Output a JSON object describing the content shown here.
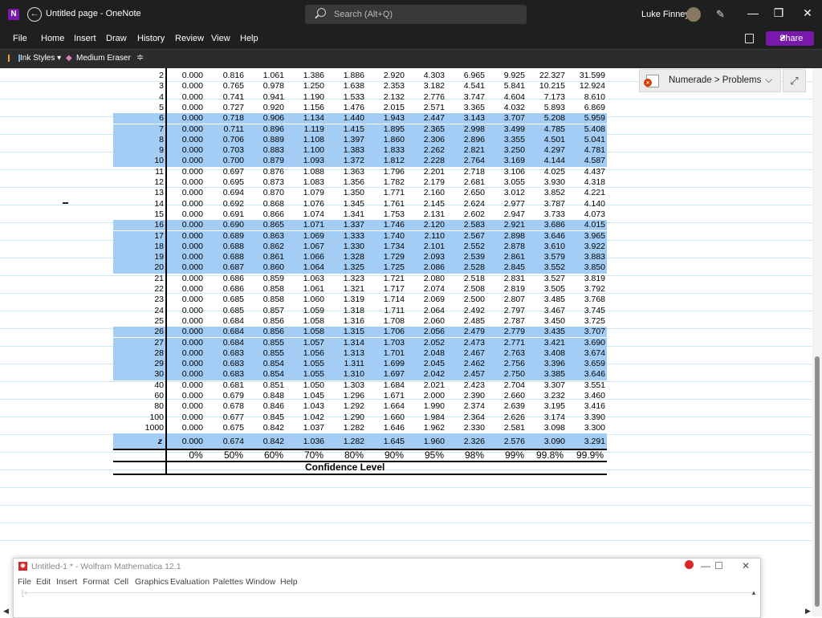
{
  "titlebar": {
    "logo": "N",
    "title": "Untitled page  -  OneNote",
    "search_placeholder": "Search (Alt+Q)",
    "user_name": "Luke Finney",
    "minimize": "—",
    "restore": "❐",
    "close": "✕"
  },
  "menu": {
    "items": [
      "File",
      "Home",
      "Insert",
      "Draw",
      "History",
      "Review",
      "View",
      "Help"
    ],
    "share": "Share"
  },
  "ribbon": {
    "ink_styles": "Ink Styles ▾",
    "eraser": "Medium Eraser",
    "more": "≑"
  },
  "numerade": {
    "label": "Numerade > Problems",
    "chevron": "⌵",
    "expand": "⤢"
  },
  "table": {
    "columns_pct": [
      "0%",
      "50%",
      "60%",
      "70%",
      "80%",
      "90%",
      "95%",
      "98%",
      "99%",
      "99.8%",
      "99.9%"
    ],
    "footer_label": "Confidence Level",
    "z_label": "z",
    "z_values": [
      "0.000",
      "0.674",
      "0.842",
      "1.036",
      "1.282",
      "1.645",
      "1.960",
      "2.326",
      "2.576",
      "3.090",
      "3.291"
    ],
    "rows": [
      {
        "df": "2",
        "hl": false,
        "v": [
          "0.000",
          "0.816",
          "1.061",
          "1.386",
          "1.886",
          "2.920",
          "4.303",
          "6.965",
          "9.925",
          "22.327",
          "31.599"
        ]
      },
      {
        "df": "3",
        "hl": false,
        "v": [
          "0.000",
          "0.765",
          "0.978",
          "1.250",
          "1.638",
          "2.353",
          "3.182",
          "4.541",
          "5.841",
          "10.215",
          "12.924"
        ]
      },
      {
        "df": "4",
        "hl": false,
        "v": [
          "0.000",
          "0.741",
          "0.941",
          "1.190",
          "1.533",
          "2.132",
          "2.776",
          "3.747",
          "4.604",
          "7.173",
          "8.610"
        ]
      },
      {
        "df": "5",
        "hl": false,
        "v": [
          "0.000",
          "0.727",
          "0.920",
          "1.156",
          "1.476",
          "2.015",
          "2.571",
          "3.365",
          "4.032",
          "5.893",
          "6.869"
        ]
      },
      {
        "df": "6",
        "hl": true,
        "v": [
          "0.000",
          "0.718",
          "0.906",
          "1.134",
          "1.440",
          "1.943",
          "2.447",
          "3.143",
          "3.707",
          "5.208",
          "5.959"
        ]
      },
      {
        "df": "7",
        "hl": true,
        "v": [
          "0.000",
          "0.711",
          "0.896",
          "1.119",
          "1.415",
          "1.895",
          "2.365",
          "2.998",
          "3.499",
          "4.785",
          "5.408"
        ]
      },
      {
        "df": "8",
        "hl": true,
        "v": [
          "0.000",
          "0.706",
          "0.889",
          "1.108",
          "1.397",
          "1.860",
          "2.306",
          "2.896",
          "3.355",
          "4.501",
          "5.041"
        ]
      },
      {
        "df": "9",
        "hl": true,
        "v": [
          "0.000",
          "0.703",
          "0.883",
          "1.100",
          "1.383",
          "1.833",
          "2.262",
          "2.821",
          "3.250",
          "4.297",
          "4.781"
        ]
      },
      {
        "df": "10",
        "hl": true,
        "v": [
          "0.000",
          "0.700",
          "0.879",
          "1.093",
          "1.372",
          "1.812",
          "2.228",
          "2.764",
          "3.169",
          "4.144",
          "4.587"
        ]
      },
      {
        "df": "11",
        "hl": false,
        "v": [
          "0.000",
          "0.697",
          "0.876",
          "1.088",
          "1.363",
          "1.796",
          "2.201",
          "2.718",
          "3.106",
          "4.025",
          "4.437"
        ]
      },
      {
        "df": "12",
        "hl": false,
        "v": [
          "0.000",
          "0.695",
          "0.873",
          "1.083",
          "1.356",
          "1.782",
          "2.179",
          "2.681",
          "3.055",
          "3.930",
          "4.318"
        ]
      },
      {
        "df": "13",
        "hl": false,
        "v": [
          "0.000",
          "0.694",
          "0.870",
          "1.079",
          "1.350",
          "1.771",
          "2.160",
          "2.650",
          "3.012",
          "3.852",
          "4.221"
        ]
      },
      {
        "df": "14",
        "hl": false,
        "v": [
          "0.000",
          "0.692",
          "0.868",
          "1.076",
          "1.345",
          "1.761",
          "2.145",
          "2.624",
          "2.977",
          "3.787",
          "4.140"
        ]
      },
      {
        "df": "15",
        "hl": false,
        "v": [
          "0.000",
          "0.691",
          "0.866",
          "1.074",
          "1.341",
          "1.753",
          "2.131",
          "2.602",
          "2.947",
          "3.733",
          "4.073"
        ]
      },
      {
        "df": "16",
        "hl": true,
        "v": [
          "0.000",
          "0.690",
          "0.865",
          "1.071",
          "1.337",
          "1.746",
          "2.120",
          "2.583",
          "2.921",
          "3.686",
          "4.015"
        ]
      },
      {
        "df": "17",
        "hl": true,
        "v": [
          "0.000",
          "0.689",
          "0.863",
          "1.069",
          "1.333",
          "1.740",
          "2.110",
          "2.567",
          "2.898",
          "3.646",
          "3.965"
        ]
      },
      {
        "df": "18",
        "hl": true,
        "v": [
          "0.000",
          "0.688",
          "0.862",
          "1.067",
          "1.330",
          "1.734",
          "2.101",
          "2.552",
          "2.878",
          "3.610",
          "3.922"
        ]
      },
      {
        "df": "19",
        "hl": true,
        "v": [
          "0.000",
          "0.688",
          "0.861",
          "1.066",
          "1.328",
          "1.729",
          "2.093",
          "2.539",
          "2.861",
          "3.579",
          "3.883"
        ]
      },
      {
        "df": "20",
        "hl": true,
        "v": [
          "0.000",
          "0.687",
          "0.860",
          "1.064",
          "1.325",
          "1.725",
          "2.086",
          "2.528",
          "2.845",
          "3.552",
          "3.850"
        ]
      },
      {
        "df": "21",
        "hl": false,
        "v": [
          "0.000",
          "0.686",
          "0.859",
          "1.063",
          "1.323",
          "1.721",
          "2.080",
          "2.518",
          "2.831",
          "3.527",
          "3.819"
        ]
      },
      {
        "df": "22",
        "hl": false,
        "v": [
          "0.000",
          "0.686",
          "0.858",
          "1.061",
          "1.321",
          "1.717",
          "2.074",
          "2.508",
          "2.819",
          "3.505",
          "3.792"
        ]
      },
      {
        "df": "23",
        "hl": false,
        "v": [
          "0.000",
          "0.685",
          "0.858",
          "1.060",
          "1.319",
          "1.714",
          "2.069",
          "2.500",
          "2.807",
          "3.485",
          "3.768"
        ]
      },
      {
        "df": "24",
        "hl": false,
        "v": [
          "0.000",
          "0.685",
          "0.857",
          "1.059",
          "1.318",
          "1.711",
          "2.064",
          "2.492",
          "2.797",
          "3.467",
          "3.745"
        ]
      },
      {
        "df": "25",
        "hl": false,
        "v": [
          "0.000",
          "0.684",
          "0.856",
          "1.058",
          "1.316",
          "1.708",
          "2.060",
          "2.485",
          "2.787",
          "3.450",
          "3.725"
        ]
      },
      {
        "df": "26",
        "hl": true,
        "v": [
          "0.000",
          "0.684",
          "0.856",
          "1.058",
          "1.315",
          "1.706",
          "2.056",
          "2.479",
          "2.779",
          "3.435",
          "3.707"
        ]
      },
      {
        "df": "27",
        "hl": true,
        "v": [
          "0.000",
          "0.684",
          "0.855",
          "1.057",
          "1.314",
          "1.703",
          "2.052",
          "2.473",
          "2.771",
          "3.421",
          "3.690"
        ]
      },
      {
        "df": "28",
        "hl": true,
        "v": [
          "0.000",
          "0.683",
          "0.855",
          "1.056",
          "1.313",
          "1.701",
          "2.048",
          "2.467",
          "2.763",
          "3.408",
          "3.674"
        ]
      },
      {
        "df": "29",
        "hl": true,
        "v": [
          "0.000",
          "0.683",
          "0.854",
          "1.055",
          "1.311",
          "1.699",
          "2.045",
          "2.462",
          "2.756",
          "3.396",
          "3.659"
        ]
      },
      {
        "df": "30",
        "hl": true,
        "v": [
          "0.000",
          "0.683",
          "0.854",
          "1.055",
          "1.310",
          "1.697",
          "2.042",
          "2.457",
          "2.750",
          "3.385",
          "3.646"
        ]
      },
      {
        "df": "40",
        "hl": false,
        "v": [
          "0.000",
          "0.681",
          "0.851",
          "1.050",
          "1.303",
          "1.684",
          "2.021",
          "2.423",
          "2.704",
          "3.307",
          "3.551"
        ]
      },
      {
        "df": "60",
        "hl": false,
        "v": [
          "0.000",
          "0.679",
          "0.848",
          "1.045",
          "1.296",
          "1.671",
          "2.000",
          "2.390",
          "2.660",
          "3.232",
          "3.460"
        ]
      },
      {
        "df": "80",
        "hl": false,
        "v": [
          "0.000",
          "0.678",
          "0.846",
          "1.043",
          "1.292",
          "1.664",
          "1.990",
          "2.374",
          "2.639",
          "3.195",
          "3.416"
        ]
      },
      {
        "df": "100",
        "hl": false,
        "v": [
          "0.000",
          "0.677",
          "0.845",
          "1.042",
          "1.290",
          "1.660",
          "1.984",
          "2.364",
          "2.626",
          "3.174",
          "3.390"
        ]
      },
      {
        "df": "1000",
        "hl": false,
        "v": [
          "0.000",
          "0.675",
          "0.842",
          "1.037",
          "1.282",
          "1.646",
          "1.962",
          "2.330",
          "2.581",
          "3.098",
          "3.300"
        ]
      }
    ]
  },
  "mathematica": {
    "title": "Untitled-1 * - Wolfram Mathematica 12.1",
    "menu": [
      "File",
      "Edit",
      "Insert",
      "Format",
      "Cell",
      "Graphics",
      "Evaluation",
      "Palettes",
      "Window",
      "Help"
    ],
    "bracket": "[+",
    "minimize": "—",
    "restore": "☐",
    "close": "✕",
    "scroll_up": "▲"
  },
  "scroll": {
    "left_arrow": "◀",
    "right_arrow": "▶"
  },
  "colors": {
    "highlight": "#a3cdf5",
    "titlebar": "#1f1f1f",
    "accent": "#7719aa"
  }
}
